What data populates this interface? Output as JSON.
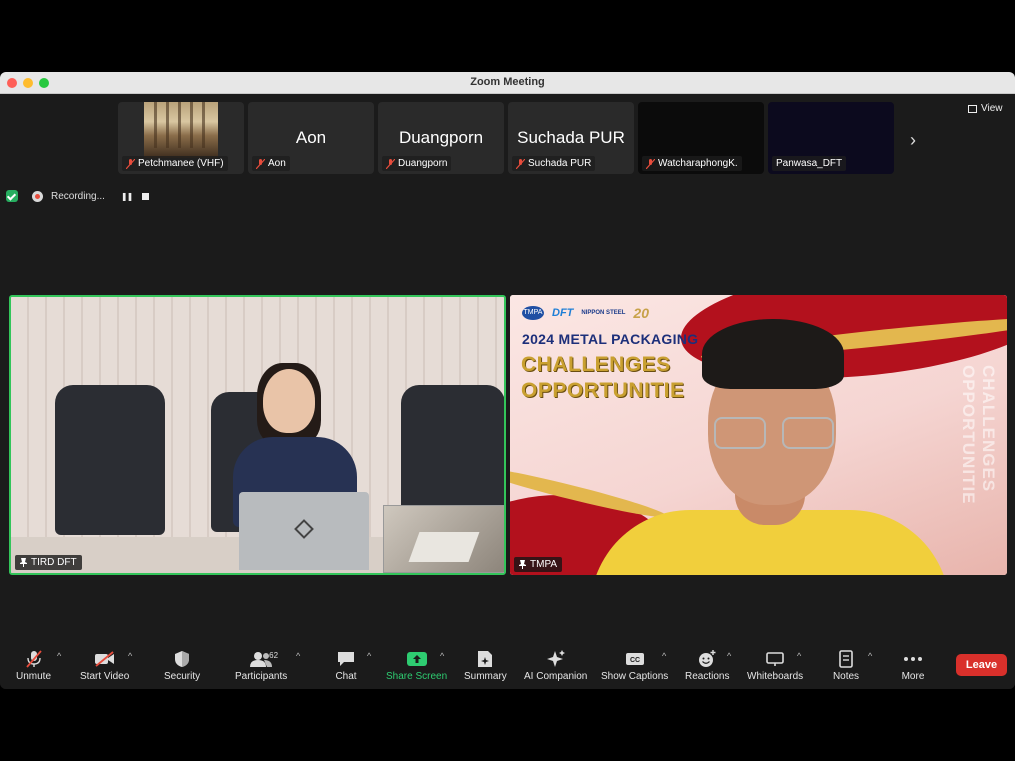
{
  "window": {
    "title": "Zoom Meeting"
  },
  "thumbnails": [
    {
      "name": "Petchmanee (VHF)",
      "big_name": "",
      "muted": true
    },
    {
      "name": "Aon",
      "big_name": "Aon",
      "muted": true
    },
    {
      "name": "Duangporn",
      "big_name": "Duangporn",
      "muted": true
    },
    {
      "name": "Suchada PUR",
      "big_name": "Suchada PUR",
      "muted": true
    },
    {
      "name": "WatcharaphongK.",
      "big_name": "",
      "muted": true
    },
    {
      "name": "Panwasa_DFT",
      "big_name": "",
      "muted": false
    }
  ],
  "view_button": "View",
  "recording": {
    "label": "Recording..."
  },
  "tiles": {
    "left": {
      "name": "TIRD DFT"
    },
    "right": {
      "name": "TMPA",
      "slide_logos": {
        "tmpa": "TMPA",
        "dft": "DFT",
        "ns": "NIPPON STEEL",
        "anniv": "20"
      },
      "slide_title": "2024 METAL PACKAGING",
      "slide_line1": "CHALLENGES",
      "slide_line2": "OPPORTUNITIE",
      "slide_vertical": "CHALLENGES OPPORTUNITIE"
    }
  },
  "toolbar": {
    "unmute": "Unmute",
    "start_video": "Start Video",
    "security": "Security",
    "participants": "Participants",
    "participants_count": "62",
    "chat": "Chat",
    "share_screen": "Share Screen",
    "summary": "Summary",
    "ai_companion": "AI Companion",
    "show_captions": "Show Captions",
    "reactions": "Reactions",
    "whiteboards": "Whiteboards",
    "notes": "Notes",
    "more": "More",
    "leave": "Leave"
  },
  "colors": {
    "active_speaker": "#33c55a",
    "leave": "#d9302b",
    "share": "#2ecc71"
  }
}
